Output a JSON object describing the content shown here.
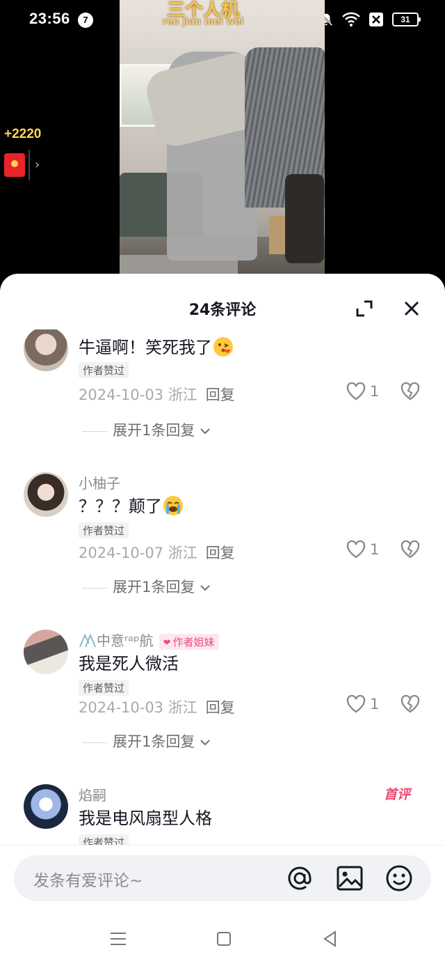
{
  "status_bar": {
    "time": "23:56",
    "notification_count": "7",
    "battery": "31"
  },
  "video": {
    "overlay_title": "三个人机",
    "overlay_subtitle": "ren jian mei wei"
  },
  "reward": {
    "amount": "+2220"
  },
  "comments_panel": {
    "title": "24条评论",
    "comments": [
      {
        "nickname": "",
        "text": "牛逼啊！笑死我了",
        "emoji": "kissing-heart",
        "badge": "作者赞过",
        "date": "2024-10-03",
        "location": "浙江",
        "reply_label": "回复",
        "likes": "1",
        "expand_label": "展开1条回复"
      },
      {
        "nickname": "小柚子",
        "text": "？？？颠了",
        "emoji": "loudly-crying",
        "badge": "作者赞过",
        "date": "2024-10-07",
        "location": "浙江",
        "reply_label": "回复",
        "likes": "1",
        "expand_label": "展开1条回复"
      },
      {
        "nickname": "中意ʳᵃᵖ航",
        "author_tag": "作者姐妹",
        "text": "我是死人微活",
        "badge": "作者赞过",
        "date": "2024-10-03",
        "location": "浙江",
        "reply_label": "回复",
        "likes": "1",
        "expand_label": "展开1条回复"
      },
      {
        "nickname": "焰嗣",
        "text": "我是电风扇型人格",
        "badge": "作者赞过",
        "first_badge": "首评"
      }
    ]
  },
  "input": {
    "placeholder": "发条有爱评论~"
  },
  "colors": {
    "accent_pink": "#ee4b7a",
    "text_primary": "#161823",
    "text_secondary": "#8a8b91",
    "reward_gold": "#ffd84d"
  }
}
